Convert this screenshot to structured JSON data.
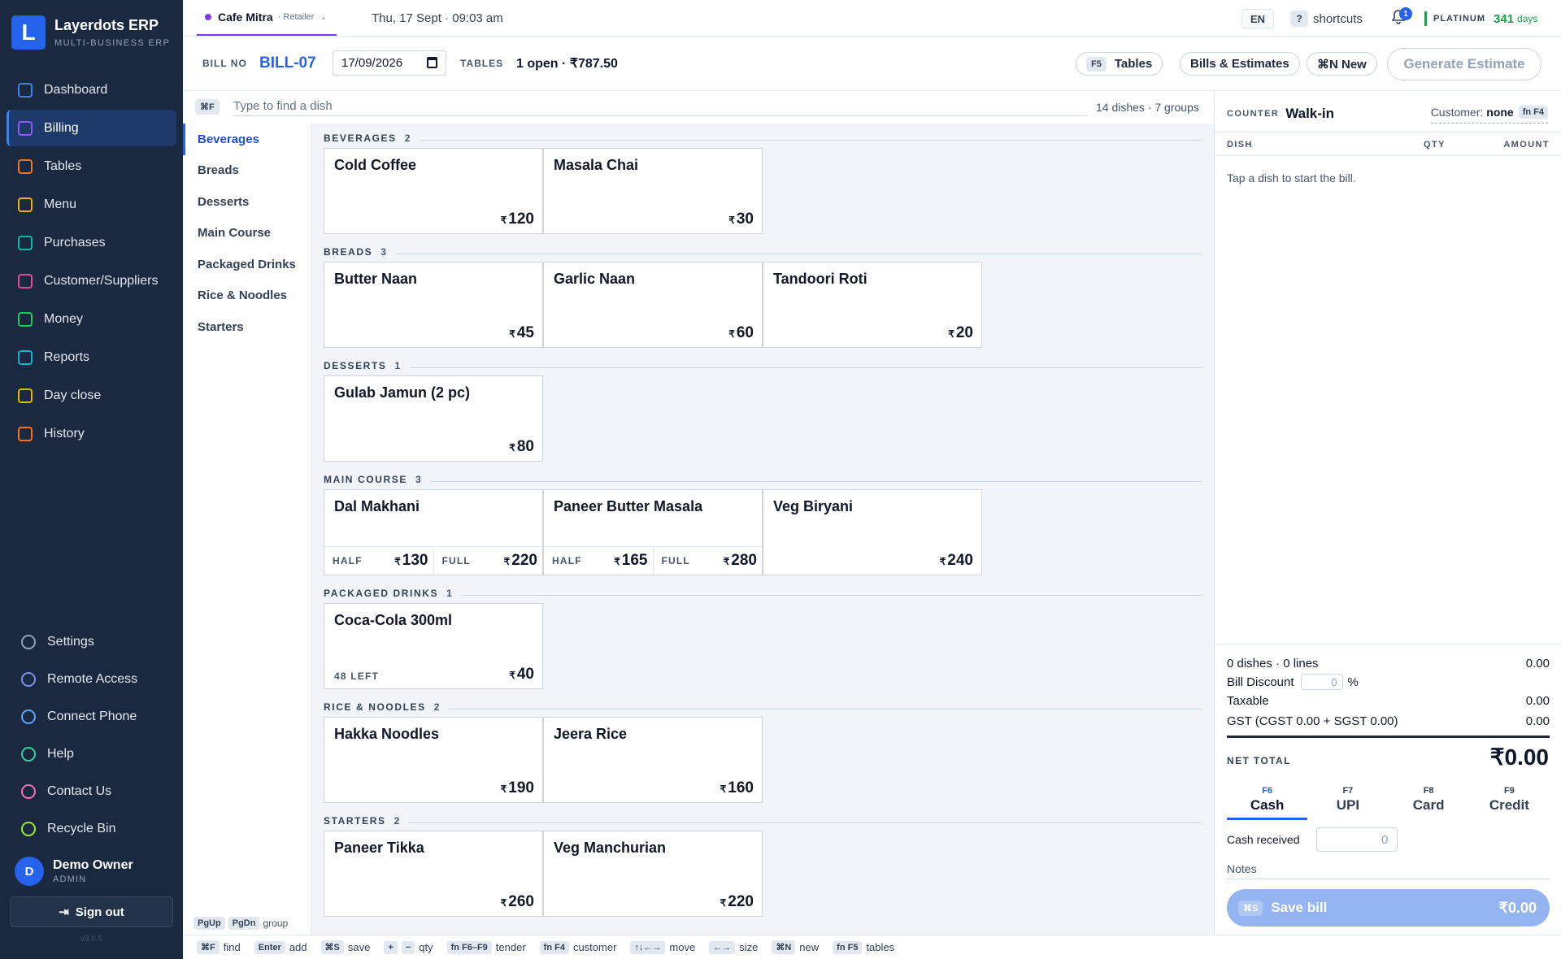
{
  "brand": {
    "name": "Layerdots ERP",
    "sub": "MULTI-BUSINESS ERP",
    "logo_letter": "L"
  },
  "nav": [
    {
      "label": "Dashboard",
      "icon": "dashboard-icon",
      "color": "#3b82f6",
      "active": false
    },
    {
      "label": "Billing",
      "icon": "billing-icon",
      "color": "#8b5cf6",
      "active": true
    },
    {
      "label": "Tables",
      "icon": "tables-icon",
      "color": "#f97316",
      "active": false
    },
    {
      "label": "Menu",
      "icon": "menu-icon",
      "color": "#eab308",
      "active": false
    },
    {
      "label": "Purchases",
      "icon": "truck-icon",
      "color": "#14b8a6",
      "active": false
    },
    {
      "label": "Customer/Suppliers",
      "icon": "people-icon",
      "color": "#ec4899",
      "active": false
    },
    {
      "label": "Money",
      "icon": "money-icon",
      "color": "#22c55e",
      "active": false
    },
    {
      "label": "Reports",
      "icon": "reports-icon",
      "color": "#06b6d4",
      "active": false
    },
    {
      "label": "Day close",
      "icon": "lock-icon",
      "color": "#eab308",
      "active": false
    },
    {
      "label": "History",
      "icon": "history-icon",
      "color": "#f97316",
      "active": false
    }
  ],
  "nav_lower": [
    {
      "label": "Settings",
      "icon": "gear-icon",
      "color": "#94a3b8"
    },
    {
      "label": "Remote Access",
      "icon": "link-icon",
      "color": "#818cf8"
    },
    {
      "label": "Connect Phone",
      "icon": "phone-icon",
      "color": "#60a5fa"
    },
    {
      "label": "Help",
      "icon": "help-icon",
      "color": "#34d399"
    },
    {
      "label": "Contact Us",
      "icon": "mail-icon",
      "color": "#f472b6"
    },
    {
      "label": "Recycle Bin",
      "icon": "recycle-icon",
      "color": "#a3e635"
    }
  ],
  "user": {
    "initial": "D",
    "name": "Demo Owner",
    "role": "ADMIN",
    "signout": "Sign out",
    "version": "v3.0.5"
  },
  "topbar": {
    "shop": "Cafe Mitra",
    "shop_type": "· Retailer",
    "datetime": "Thu, 17 Sept · 09:03 am",
    "lang": "EN",
    "shortcut_key": "?",
    "shortcuts": "shortcuts",
    "notif_count": "1",
    "plan": "PLATINUM",
    "plan_days": "341",
    "plan_unit": "days"
  },
  "bill": {
    "billno_label": "BILL NO",
    "billno": "BILL-07",
    "date": "17/09/2026",
    "tables_label": "TABLES",
    "tables_value": "1 open · ₹787.50",
    "btn_tables_key": "F5",
    "btn_tables": "Tables",
    "btn_bills": "Bills & Estimates",
    "btn_new": "⌘N New",
    "btn_generate": "Generate Estimate"
  },
  "search": {
    "key": "⌘F",
    "placeholder": "Type to find a dish",
    "count": "14 dishes · 7 groups"
  },
  "groups": [
    "Beverages",
    "Breads",
    "Desserts",
    "Main Course",
    "Packaged Drinks",
    "Rice & Noodles",
    "Starters"
  ],
  "group_hint": {
    "k1": "PgUp",
    "k2": "PgDn",
    "text": "group"
  },
  "sections": [
    {
      "name": "BEVERAGES",
      "count": "2",
      "dishes": [
        {
          "name": "Cold Coffee",
          "price": "120"
        },
        {
          "name": "Masala Chai",
          "price": "30"
        }
      ]
    },
    {
      "name": "BREADS",
      "count": "3",
      "dishes": [
        {
          "name": "Butter Naan",
          "price": "45"
        },
        {
          "name": "Garlic Naan",
          "price": "60"
        },
        {
          "name": "Tandoori Roti",
          "price": "20"
        }
      ]
    },
    {
      "name": "DESSERTS",
      "count": "1",
      "dishes": [
        {
          "name": "Gulab Jamun (2 pc)",
          "price": "80"
        }
      ]
    },
    {
      "name": "MAIN COURSE",
      "count": "3",
      "dishes": [
        {
          "name": "Dal Makhani",
          "variants": [
            {
              "label": "HALF",
              "price": "130"
            },
            {
              "label": "FULL",
              "price": "220"
            }
          ]
        },
        {
          "name": "Paneer Butter Masala",
          "variants": [
            {
              "label": "HALF",
              "price": "165"
            },
            {
              "label": "FULL",
              "price": "280"
            }
          ]
        },
        {
          "name": "Veg Biryani",
          "price": "240"
        }
      ]
    },
    {
      "name": "PACKAGED DRINKS",
      "count": "1",
      "dishes": [
        {
          "name": "Coca-Cola 300ml",
          "price": "40",
          "stock": "48 LEFT"
        }
      ]
    },
    {
      "name": "RICE & NOODLES",
      "count": "2",
      "dishes": [
        {
          "name": "Hakka Noodles",
          "price": "190"
        },
        {
          "name": "Jeera Rice",
          "price": "160"
        }
      ]
    },
    {
      "name": "STARTERS",
      "count": "2",
      "dishes": [
        {
          "name": "Paneer Tikka",
          "price": "260"
        },
        {
          "name": "Veg Manchurian",
          "price": "220"
        }
      ]
    }
  ],
  "currency": "₹",
  "panel": {
    "counter_label": "COUNTER",
    "counter": "Walk-in",
    "customer_label": "Customer:",
    "customer": "none",
    "customer_key": "fn F4",
    "col_dish": "DISH",
    "col_qty": "QTY",
    "col_amount": "AMOUNT",
    "empty": "Tap a dish to start the bill.",
    "dishes_lines": "0 dishes · 0 lines",
    "dishes_lines_val": "0.00",
    "discount_label": "Bill Discount",
    "discount_val": "0",
    "discount_unit": "%",
    "taxable_label": "Taxable",
    "taxable_val": "0.00",
    "gst_label": "GST (CGST 0.00 + SGST 0.00)",
    "gst_val": "0.00",
    "net_label": "NET TOTAL",
    "net_val": "₹0.00",
    "tenders": [
      {
        "key": "F6",
        "label": "Cash",
        "active": true
      },
      {
        "key": "F7",
        "label": "UPI",
        "active": false
      },
      {
        "key": "F8",
        "label": "Card",
        "active": false
      },
      {
        "key": "F9",
        "label": "Credit",
        "active": false
      }
    ],
    "cash_label": "Cash received",
    "cash_val": "0",
    "notes": "Notes",
    "save_key": "⌘S",
    "save_label": "Save bill",
    "save_val": "₹0.00"
  },
  "hints": [
    {
      "keys": [
        "⌘F"
      ],
      "text": "find"
    },
    {
      "keys": [
        "Enter"
      ],
      "text": "add"
    },
    {
      "keys": [
        "⌘S"
      ],
      "text": "save"
    },
    {
      "keys": [
        "+",
        "−"
      ],
      "text": "qty"
    },
    {
      "keys": [
        "fn F6–F9"
      ],
      "text": "tender"
    },
    {
      "keys": [
        "fn F4"
      ],
      "text": "customer"
    },
    {
      "keys": [
        "↑↓←→"
      ],
      "text": "move"
    },
    {
      "keys": [
        "←→"
      ],
      "text": "size"
    },
    {
      "keys": [
        "⌘N"
      ],
      "text": "new"
    },
    {
      "keys": [
        "fn F5"
      ],
      "text": "tables"
    }
  ]
}
